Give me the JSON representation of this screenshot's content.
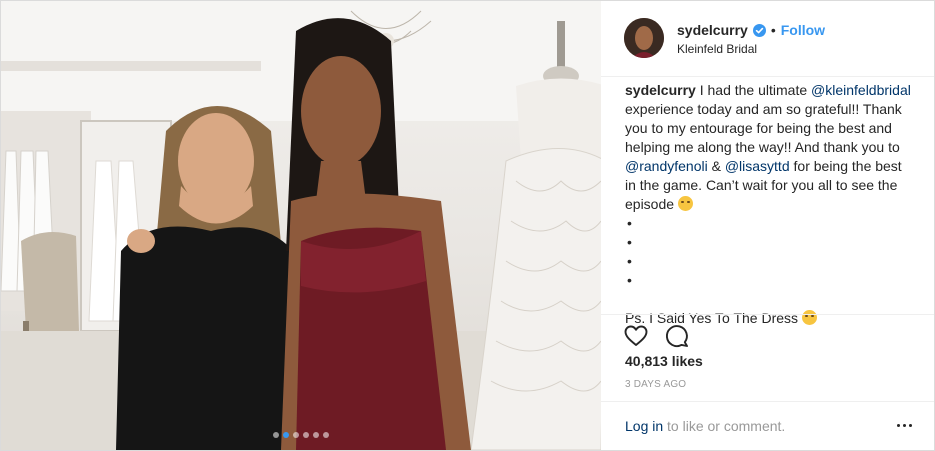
{
  "post": {
    "username": "sydelcurry",
    "follow_label": "Follow",
    "separator": "•",
    "location": "Kleinfeld Bridal",
    "caption": {
      "user": "sydelcurry",
      "part1": " I had the ultimate ",
      "mention1": "@kleinfeldbridal",
      "part2": " experience today and am so grateful!! Thank you to my entourage for being the best and helping me along the way!! And thank you to ",
      "mention2": "@randyfenoli",
      "part3": " & ",
      "mention3": "@lisasyttd",
      "part4": " for being the best in the game. Can’t wait for you all to see the episode ",
      "bullets": [
        "•",
        "•",
        "•",
        "•"
      ],
      "ps": "Ps. I Said Yes To The Dress "
    },
    "likes": "40,813 likes",
    "timestamp": "3 DAYS AGO",
    "login_link": "Log in",
    "login_rest": " to like or comment."
  },
  "carousel": {
    "count": 6,
    "active_index": 1
  },
  "colors": {
    "accent": "#3897f0",
    "mention": "#003569",
    "muted": "#999999"
  },
  "icons": [
    "verified-badge-icon",
    "heart-icon",
    "comment-icon",
    "more-options-icon"
  ]
}
